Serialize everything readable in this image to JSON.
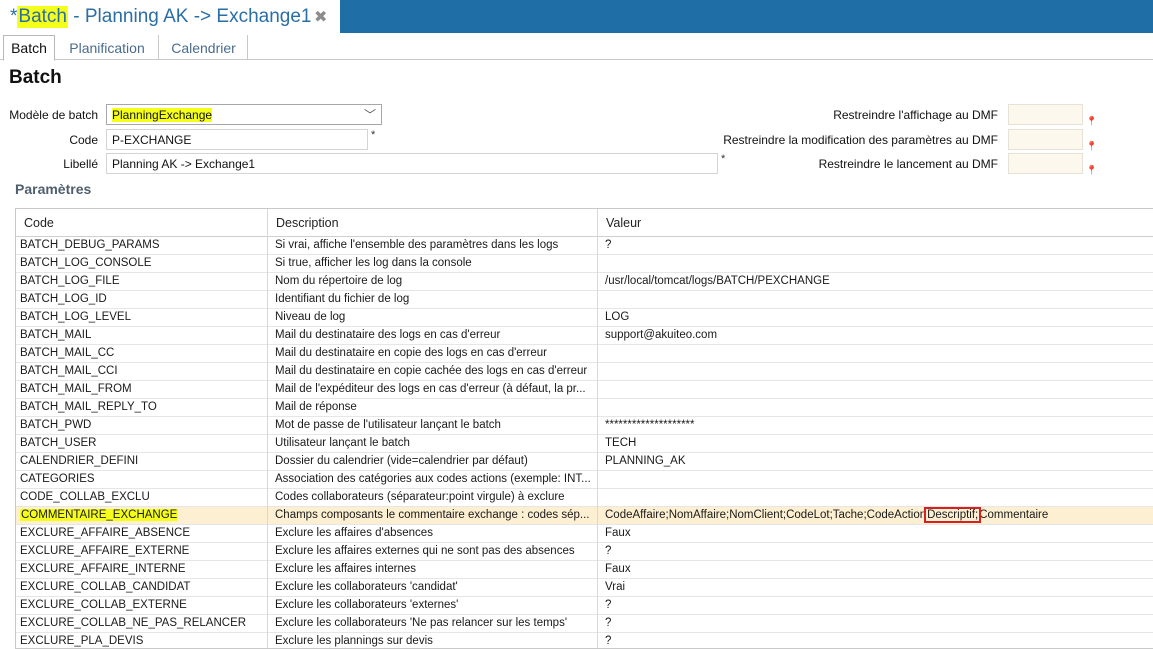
{
  "editor_tab": {
    "prefix": "*",
    "highlighted": "Batch",
    "rest": " - Planning AK -> Exchange1",
    "close_glyph": "✖"
  },
  "subtabs": [
    "Batch",
    "Planification",
    "Calendrier"
  ],
  "heading": "Batch",
  "form": {
    "model_label": "Modèle de batch",
    "model_value": "PlanningExchange",
    "code_label": "Code",
    "code_value": "P-EXCHANGE",
    "libelle_label": "Libellé",
    "libelle_value": "Planning AK -> Exchange1",
    "required_mark": "*",
    "dmf_display_label": "Restreindre l'affichage au DMF",
    "dmf_modify_label": "Restreindre la modification des paramètres au DMF",
    "dmf_launch_label": "Restreindre le lancement au DMF",
    "pin_glyph": "📍"
  },
  "params_title": "Paramètres",
  "table": {
    "columns": [
      "Code",
      "Description",
      "Valeur"
    ],
    "rows": [
      {
        "code": "BATCH_DEBUG_PARAMS",
        "desc": "Si vrai, affiche l'ensemble des paramètres dans les logs",
        "val": "?"
      },
      {
        "code": "BATCH_LOG_CONSOLE",
        "desc": "Si true, afficher les log dans la console",
        "val": ""
      },
      {
        "code": "BATCH_LOG_FILE",
        "desc": "Nom du répertoire de log",
        "val": "/usr/local/tomcat/logs/BATCH/PEXCHANGE"
      },
      {
        "code": "BATCH_LOG_ID",
        "desc": "Identifiant du fichier de log",
        "val": ""
      },
      {
        "code": "BATCH_LOG_LEVEL",
        "desc": "Niveau de log",
        "val": "LOG"
      },
      {
        "code": "BATCH_MAIL",
        "desc": "Mail du destinataire des logs en cas d'erreur",
        "val": "support@akuiteo.com"
      },
      {
        "code": "BATCH_MAIL_CC",
        "desc": "Mail du destinataire en copie des logs en cas d'erreur",
        "val": ""
      },
      {
        "code": "BATCH_MAIL_CCI",
        "desc": "Mail du destinataire en copie cachée des logs en cas d'erreur",
        "val": ""
      },
      {
        "code": "BATCH_MAIL_FROM",
        "desc": "Mail de l'expéditeur des logs en cas d'erreur (à défaut, la pr...",
        "val": ""
      },
      {
        "code": "BATCH_MAIL_REPLY_TO",
        "desc": "Mail de réponse",
        "val": ""
      },
      {
        "code": "BATCH_PWD",
        "desc": "Mot de passe de l'utilisateur lançant le batch",
        "val": "********************"
      },
      {
        "code": "BATCH_USER",
        "desc": "Utilisateur lançant le batch",
        "val": "TECH"
      },
      {
        "code": "CALENDRIER_DEFINI",
        "desc": "Dossier du calendrier (vide=calendrier par défaut)",
        "val": "PLANNING_AK"
      },
      {
        "code": "CATEGORIES",
        "desc": "Association des catégories aux codes actions (exemple: INT...",
        "val": ""
      },
      {
        "code": "CODE_COLLAB_EXCLU",
        "desc": "Codes collaborateurs (séparateur:point virgule) à exclure",
        "val": ""
      },
      {
        "code": "COMMENTAIRE_EXCHANGE",
        "desc": "Champs composants le commentaire exchange : codes sép...",
        "val": "",
        "selected": true
      },
      {
        "code": "EXCLURE_AFFAIRE_ABSENCE",
        "desc": "Exclure les affaires d'absences",
        "val": "Faux"
      },
      {
        "code": "EXCLURE_AFFAIRE_EXTERNE",
        "desc": "Exclure les affaires externes qui ne sont pas des absences",
        "val": "?"
      },
      {
        "code": "EXCLURE_AFFAIRE_INTERNE",
        "desc": "Exclure les affaires internes",
        "val": "Faux"
      },
      {
        "code": "EXCLURE_COLLAB_CANDIDAT",
        "desc": "Exclure les collaborateurs 'candidat'",
        "val": "Vrai"
      },
      {
        "code": "EXCLURE_COLLAB_EXTERNE",
        "desc": "Exclure les collaborateurs 'externes'",
        "val": "?"
      },
      {
        "code": "EXCLURE_COLLAB_NE_PAS_RELANCER",
        "desc": "Exclure les collaborateurs 'Ne pas relancer sur les temps'",
        "val": "?"
      },
      {
        "code": "EXCLURE_PLA_DEVIS",
        "desc": "Exclure les plannings sur devis",
        "val": "?"
      }
    ],
    "selected_value": {
      "before": "CodeAffaire;NomAffaire;NomClient;CodeLot;Tache;CodeAction",
      "boxed": "Descriptif;",
      "after": "Commentaire"
    }
  }
}
